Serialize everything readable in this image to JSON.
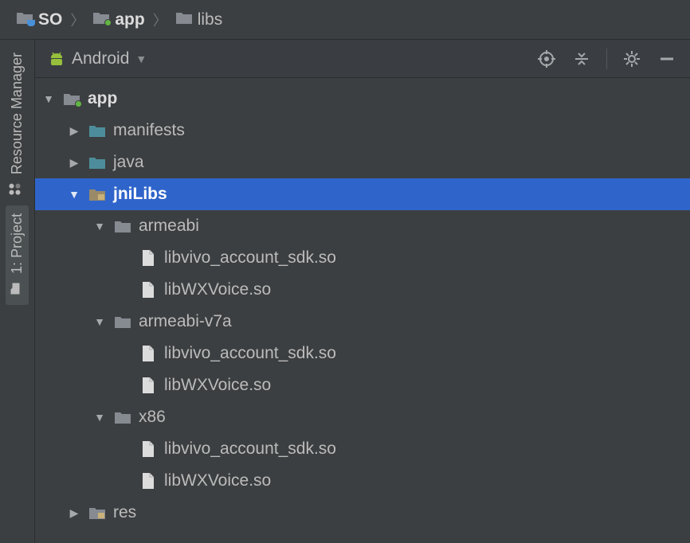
{
  "breadcrumbs": [
    {
      "label": "SO",
      "icon": "module-folder"
    },
    {
      "label": "app",
      "icon": "module-folder-green"
    },
    {
      "label": "libs",
      "icon": "folder"
    }
  ],
  "sidebar_tabs": {
    "resource_manager": "Resource Manager",
    "project": "1: Project"
  },
  "panel": {
    "view_label": "Android"
  },
  "tree": {
    "app": "app",
    "manifests": "manifests",
    "java": "java",
    "jniLibs": "jniLibs",
    "armeabi": "armeabi",
    "armeabi_v7a": "armeabi-v7a",
    "x86": "x86",
    "res": "res",
    "file_vivo": "libvivo_account_sdk.so",
    "file_wx": "libWXVoice.so"
  },
  "colors": {
    "selection": "#2f65ca",
    "bg": "#3c3f41",
    "folder_gray": "#868a91",
    "folder_teal": "#4d8d9b",
    "android_green": "#97c03c"
  }
}
